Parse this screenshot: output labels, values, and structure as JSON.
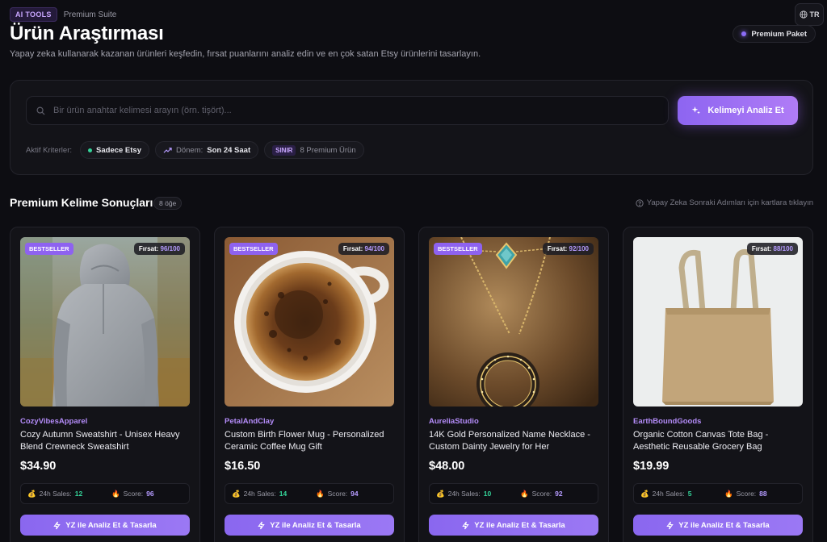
{
  "header": {
    "tag": "AI TOOLS",
    "suite": "Premium Suite",
    "title": "Ürün Araştırması",
    "subtitle": "Yapay zeka kullanarak kazanan ürünleri keşfedin, fırsat puanlarını analiz edin ve en çok satan Etsy ürünlerini tasarlayın.",
    "lang": "TR",
    "plan": "Premium Paket"
  },
  "search": {
    "placeholder": "Bir ürün anahtar kelimesi arayın (örn. tişört)...",
    "value": "",
    "button": "Kelimeyi Analiz Et"
  },
  "criteria": {
    "label": "Aktif Kriterler:",
    "source": "Sadece Etsy",
    "period_label": "Dönem:",
    "period_value": "Son 24 Saat",
    "limit_tag": "SINIR",
    "limit_value": "8 Premium Ürün"
  },
  "results": {
    "title": "Premium Kelime Sonuçları",
    "count": "8 öğe",
    "hint": "Yapay Zeka Sonraki Adımları için kartlara tıklayın"
  },
  "labels": {
    "score_prefix": "Fırsat:",
    "sales_label": "24h Sales:",
    "score_label": "Score:",
    "action": "YZ ile Analiz Et & Tasarla",
    "bestseller": "BESTSELLER"
  },
  "products": [
    {
      "store": "CozyVibesApparel",
      "name": "Cozy Autumn Sweatshirt - Unisex Heavy Blend Crewneck Sweatshirt",
      "price": "$34.90",
      "sales": "12",
      "score": "96",
      "opportunity": "96/100",
      "image": "hoodie"
    },
    {
      "store": "PetalAndClay",
      "name": "Custom Birth Flower Mug - Personalized Ceramic Coffee Mug Gift",
      "price": "$16.50",
      "sales": "14",
      "score": "94",
      "opportunity": "94/100",
      "image": "coffee-mug"
    },
    {
      "store": "AureliaStudio",
      "name": "14K Gold Personalized Name Necklace - Custom Dainty Jewelry for Her",
      "price": "$48.00",
      "sales": "10",
      "score": "92",
      "opportunity": "92/100",
      "image": "necklace"
    },
    {
      "store": "EarthBoundGoods",
      "name": "Organic Cotton Canvas Tote Bag - Aesthetic Reusable Grocery Bag",
      "price": "$19.99",
      "sales": "5",
      "score": "88",
      "opportunity": "88/100",
      "image": "tote-bag"
    }
  ],
  "colors": {
    "accent": "#8d65f1",
    "green": "#34d399",
    "background": "#0d0d12"
  }
}
